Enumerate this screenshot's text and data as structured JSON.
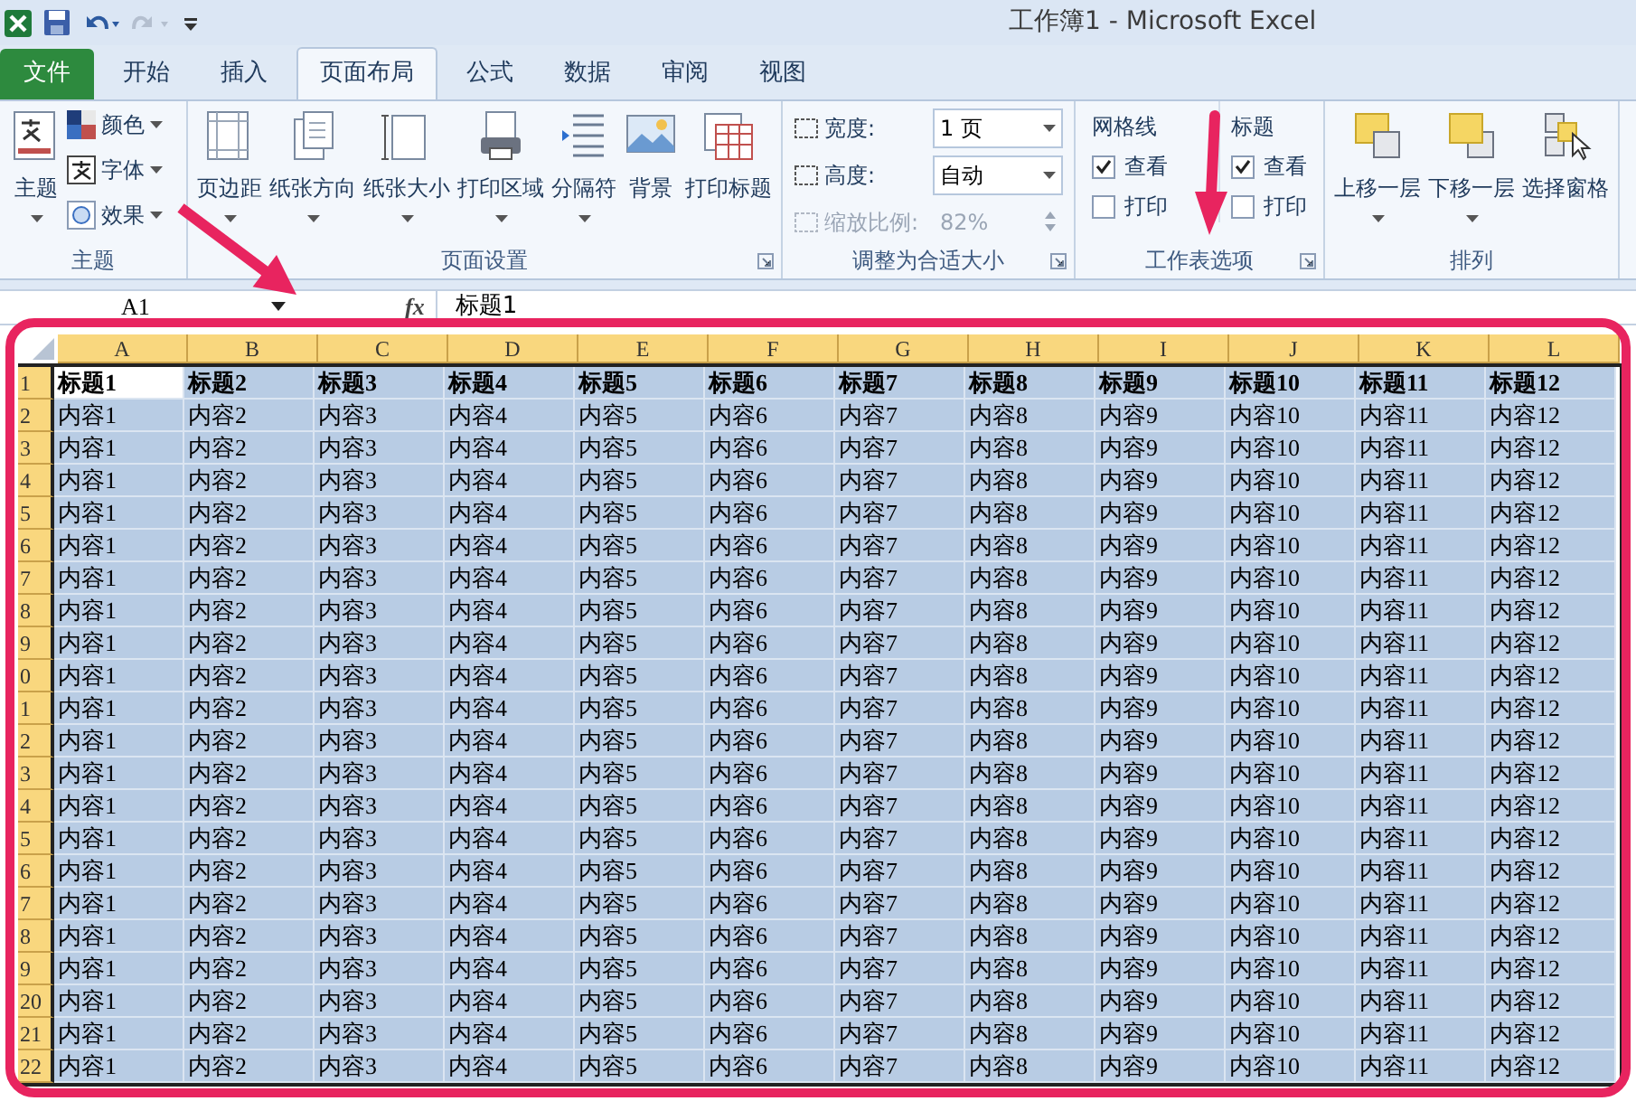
{
  "window": {
    "title": "工作簿1  -  Microsoft Excel"
  },
  "tabs": [
    {
      "label": "文件",
      "kind": "file",
      "selected": false
    },
    {
      "label": "开始",
      "kind": "tab",
      "selected": false
    },
    {
      "label": "插入",
      "kind": "tab",
      "selected": false
    },
    {
      "label": "页面布局",
      "kind": "tab",
      "selected": true
    },
    {
      "label": "公式",
      "kind": "tab",
      "selected": false
    },
    {
      "label": "数据",
      "kind": "tab",
      "selected": false
    },
    {
      "label": "审阅",
      "kind": "tab",
      "selected": false
    },
    {
      "label": "视图",
      "kind": "tab",
      "selected": false
    }
  ],
  "ribbon": {
    "groups": [
      {
        "label": "主题",
        "kind": "theme",
        "large": {
          "label": "主题",
          "dropdown": true
        },
        "small": [
          {
            "label": "颜色",
            "dropdown": true
          },
          {
            "label": "字体",
            "dropdown": true
          },
          {
            "label": "效果",
            "dropdown": true
          }
        ]
      },
      {
        "label": "页面设置",
        "kind": "buttons",
        "launcher": true,
        "buttons": [
          {
            "label": "页边距",
            "dropdown": true
          },
          {
            "label": "纸张方向",
            "dropdown": true
          },
          {
            "label": "纸张大小",
            "dropdown": true
          },
          {
            "label": "打印区域",
            "dropdown": true
          },
          {
            "label": "分隔符",
            "dropdown": true
          },
          {
            "label": "背景",
            "dropdown": false
          },
          {
            "label": "打印标题",
            "dropdown": false
          }
        ]
      },
      {
        "label": "调整为合适大小",
        "kind": "fit",
        "launcher": true,
        "fields": [
          {
            "label": "宽度:",
            "value": "1 页",
            "disabled": false
          },
          {
            "label": "高度:",
            "value": "自动",
            "disabled": false
          },
          {
            "label": "缩放比例:",
            "value": "82%",
            "disabled": true
          }
        ]
      },
      {
        "label": "工作表选项",
        "kind": "options",
        "launcher": true,
        "sections": [
          {
            "title": "网格线",
            "options": [
              {
                "label": "查看",
                "checked": true
              },
              {
                "label": "打印",
                "checked": false
              }
            ]
          },
          {
            "title": "标题",
            "options": [
              {
                "label": "查看",
                "checked": true
              },
              {
                "label": "打印",
                "checked": false
              }
            ]
          }
        ]
      },
      {
        "label": "排列",
        "kind": "buttons",
        "buttons": [
          {
            "label": "上移一层",
            "dropdown": true
          },
          {
            "label": "下移一层",
            "dropdown": true
          },
          {
            "label": "选择窗格",
            "dropdown": false
          }
        ]
      }
    ]
  },
  "formula_bar": {
    "name_box": "A1",
    "function_label": "fx",
    "formula": "标题1"
  },
  "sheet": {
    "columns": [
      "A",
      "B",
      "C",
      "D",
      "E",
      "F",
      "G",
      "H",
      "I",
      "J",
      "K",
      "L"
    ],
    "rows": [
      {
        "header": "1",
        "kind": "heading",
        "selected": true,
        "cells": [
          {
            "text": "标题1",
            "active": true
          },
          {
            "text": "标题2",
            "active": false
          },
          {
            "text": "标题3",
            "active": false
          },
          {
            "text": "标题4",
            "active": false
          },
          {
            "text": "标题5",
            "active": false
          },
          {
            "text": "标题6",
            "active": false
          },
          {
            "text": "标题7",
            "active": false
          },
          {
            "text": "标题8",
            "active": false
          },
          {
            "text": "标题9",
            "active": false
          },
          {
            "text": "标题10",
            "active": false
          },
          {
            "text": "标题11",
            "active": false
          },
          {
            "text": "标题12",
            "active": false
          }
        ]
      },
      {
        "header": "2",
        "kind": "data",
        "selected": true,
        "cells": [
          "内容1",
          "内容2",
          "内容3",
          "内容4",
          "内容5",
          "内容6",
          "内容7",
          "内容8",
          "内容9",
          "内容10",
          "内容11",
          "内容12"
        ]
      },
      {
        "header": "3",
        "kind": "data",
        "selected": true,
        "cells": [
          "内容1",
          "内容2",
          "内容3",
          "内容4",
          "内容5",
          "内容6",
          "内容7",
          "内容8",
          "内容9",
          "内容10",
          "内容11",
          "内容12"
        ]
      },
      {
        "header": "4",
        "kind": "data",
        "selected": true,
        "cells": [
          "内容1",
          "内容2",
          "内容3",
          "内容4",
          "内容5",
          "内容6",
          "内容7",
          "内容8",
          "内容9",
          "内容10",
          "内容11",
          "内容12"
        ]
      },
      {
        "header": "5",
        "kind": "data",
        "selected": true,
        "cells": [
          "内容1",
          "内容2",
          "内容3",
          "内容4",
          "内容5",
          "内容6",
          "内容7",
          "内容8",
          "内容9",
          "内容10",
          "内容11",
          "内容12"
        ]
      },
      {
        "header": "6",
        "kind": "data",
        "selected": true,
        "cells": [
          "内容1",
          "内容2",
          "内容3",
          "内容4",
          "内容5",
          "内容6",
          "内容7",
          "内容8",
          "内容9",
          "内容10",
          "内容11",
          "内容12"
        ]
      },
      {
        "header": "7",
        "kind": "data",
        "selected": true,
        "cells": [
          "内容1",
          "内容2",
          "内容3",
          "内容4",
          "内容5",
          "内容6",
          "内容7",
          "内容8",
          "内容9",
          "内容10",
          "内容11",
          "内容12"
        ]
      },
      {
        "header": "8",
        "kind": "data",
        "selected": true,
        "cells": [
          "内容1",
          "内容2",
          "内容3",
          "内容4",
          "内容5",
          "内容6",
          "内容7",
          "内容8",
          "内容9",
          "内容10",
          "内容11",
          "内容12"
        ]
      },
      {
        "header": "9",
        "kind": "data",
        "selected": true,
        "cells": [
          "内容1",
          "内容2",
          "内容3",
          "内容4",
          "内容5",
          "内容6",
          "内容7",
          "内容8",
          "内容9",
          "内容10",
          "内容11",
          "内容12"
        ]
      },
      {
        "header": "0",
        "kind": "data",
        "selected": true,
        "cells": [
          "内容1",
          "内容2",
          "内容3",
          "内容4",
          "内容5",
          "内容6",
          "内容7",
          "内容8",
          "内容9",
          "内容10",
          "内容11",
          "内容12"
        ]
      },
      {
        "header": "1",
        "kind": "data",
        "selected": true,
        "cells": [
          "内容1",
          "内容2",
          "内容3",
          "内容4",
          "内容5",
          "内容6",
          "内容7",
          "内容8",
          "内容9",
          "内容10",
          "内容11",
          "内容12"
        ]
      },
      {
        "header": "2",
        "kind": "data",
        "selected": true,
        "cells": [
          "内容1",
          "内容2",
          "内容3",
          "内容4",
          "内容5",
          "内容6",
          "内容7",
          "内容8",
          "内容9",
          "内容10",
          "内容11",
          "内容12"
        ]
      },
      {
        "header": "3",
        "kind": "data",
        "selected": true,
        "cells": [
          "内容1",
          "内容2",
          "内容3",
          "内容4",
          "内容5",
          "内容6",
          "内容7",
          "内容8",
          "内容9",
          "内容10",
          "内容11",
          "内容12"
        ]
      },
      {
        "header": "4",
        "kind": "data",
        "selected": true,
        "cells": [
          "内容1",
          "内容2",
          "内容3",
          "内容4",
          "内容5",
          "内容6",
          "内容7",
          "内容8",
          "内容9",
          "内容10",
          "内容11",
          "内容12"
        ]
      },
      {
        "header": "5",
        "kind": "data",
        "selected": true,
        "cells": [
          "内容1",
          "内容2",
          "内容3",
          "内容4",
          "内容5",
          "内容6",
          "内容7",
          "内容8",
          "内容9",
          "内容10",
          "内容11",
          "内容12"
        ]
      },
      {
        "header": "6",
        "kind": "data",
        "selected": true,
        "cells": [
          "内容1",
          "内容2",
          "内容3",
          "内容4",
          "内容5",
          "内容6",
          "内容7",
          "内容8",
          "内容9",
          "内容10",
          "内容11",
          "内容12"
        ]
      },
      {
        "header": "7",
        "kind": "data",
        "selected": true,
        "cells": [
          "内容1",
          "内容2",
          "内容3",
          "内容4",
          "内容5",
          "内容6",
          "内容7",
          "内容8",
          "内容9",
          "内容10",
          "内容11",
          "内容12"
        ]
      },
      {
        "header": "8",
        "kind": "data",
        "selected": true,
        "cells": [
          "内容1",
          "内容2",
          "内容3",
          "内容4",
          "内容5",
          "内容6",
          "内容7",
          "内容8",
          "内容9",
          "内容10",
          "内容11",
          "内容12"
        ]
      },
      {
        "header": "9",
        "kind": "data",
        "selected": true,
        "cells": [
          "内容1",
          "内容2",
          "内容3",
          "内容4",
          "内容5",
          "内容6",
          "内容7",
          "内容8",
          "内容9",
          "内容10",
          "内容11",
          "内容12"
        ]
      },
      {
        "header": "20",
        "kind": "data",
        "selected": true,
        "cells": [
          "内容1",
          "内容2",
          "内容3",
          "内容4",
          "内容5",
          "内容6",
          "内容7",
          "内容8",
          "内容9",
          "内容10",
          "内容11",
          "内容12"
        ]
      },
      {
        "header": "21",
        "kind": "data",
        "selected": true,
        "cells": [
          "内容1",
          "内容2",
          "内容3",
          "内容4",
          "内容5",
          "内容6",
          "内容7",
          "内容8",
          "内容9",
          "内容10",
          "内容11",
          "内容12"
        ]
      },
      {
        "header": "22",
        "kind": "data",
        "selected": true,
        "cells": [
          "内容1",
          "内容2",
          "内容3",
          "内容4",
          "内容5",
          "内容6",
          "内容7",
          "内容8",
          "内容9",
          "内容10",
          "内容11",
          "内容12"
        ]
      }
    ]
  }
}
